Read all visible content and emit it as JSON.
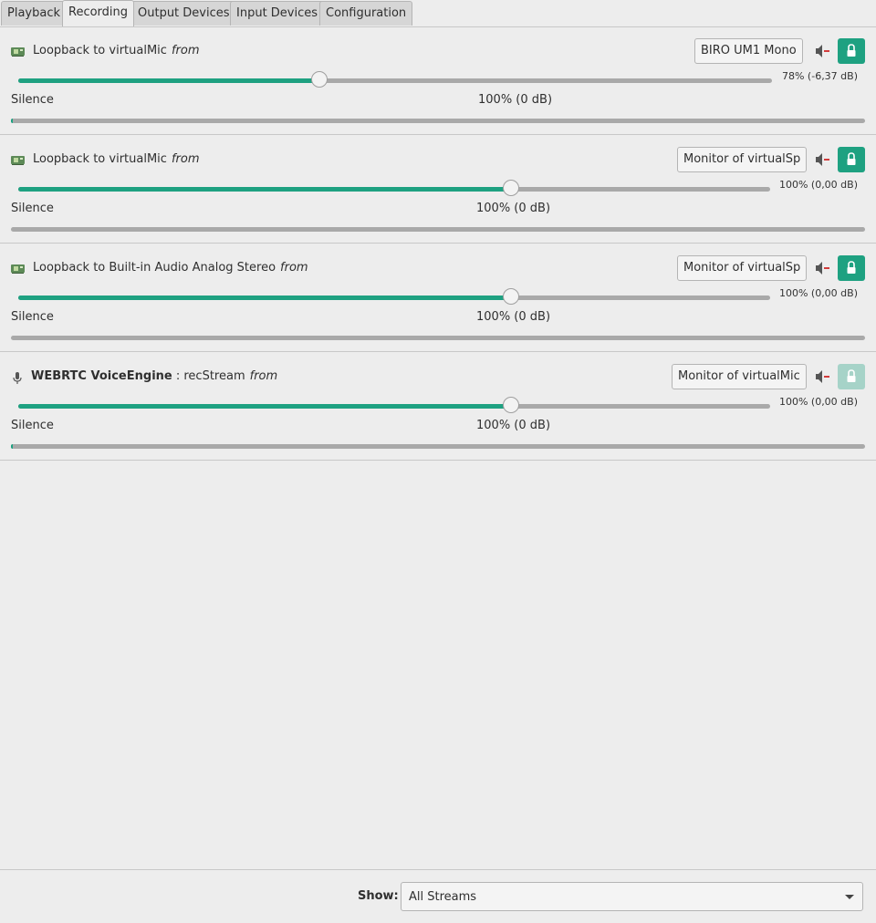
{
  "tabs": [
    "Playback",
    "Recording",
    "Output Devices",
    "Input Devices",
    "Configuration"
  ],
  "active_tab": "Recording",
  "streams": [
    {
      "icon": "sound-card-icon",
      "app": "",
      "name": "Loopback to virtualMic",
      "from_label": "from",
      "device": "BIRO UM1 Mono",
      "volume_percent": 78,
      "volume_text": "78% (-6,37 dB)",
      "silence_label": "Silence",
      "mid_label": "100% (0 dB)",
      "peak_level": 0.002,
      "locked": true
    },
    {
      "icon": "sound-card-icon",
      "app": "",
      "name": "Loopback to virtualMic",
      "from_label": "from",
      "device": "Monitor of virtualSp",
      "volume_percent": 100,
      "volume_text": "100% (0,00 dB)",
      "silence_label": "Silence",
      "mid_label": "100% (0 dB)",
      "peak_level": 0,
      "locked": true
    },
    {
      "icon": "sound-card-icon",
      "app": "",
      "name": "Loopback to Built-in Audio Analog Stereo",
      "from_label": "from",
      "device": "Monitor of virtualSp",
      "volume_percent": 100,
      "volume_text": "100% (0,00 dB)",
      "silence_label": "Silence",
      "mid_label": "100% (0 dB)",
      "peak_level": 0,
      "locked": true
    },
    {
      "icon": "microphone-icon",
      "app": "WEBRTC VoiceEngine",
      "name": "recStream",
      "from_label": "from",
      "device": "Monitor of virtualMic",
      "volume_percent": 100,
      "volume_text": "100% (0,00 dB)",
      "silence_label": "Silence",
      "mid_label": "100% (0 dB)",
      "peak_level": 0.002,
      "locked": false
    }
  ],
  "bottom": {
    "show_label": "Show:",
    "show_value": "All Streams"
  },
  "colors": {
    "accent": "#1ea181",
    "accent_dim": "#a6d3c8",
    "track": "#a9a9a9",
    "background": "#ededed",
    "mute_mark": "#d23c3c"
  }
}
